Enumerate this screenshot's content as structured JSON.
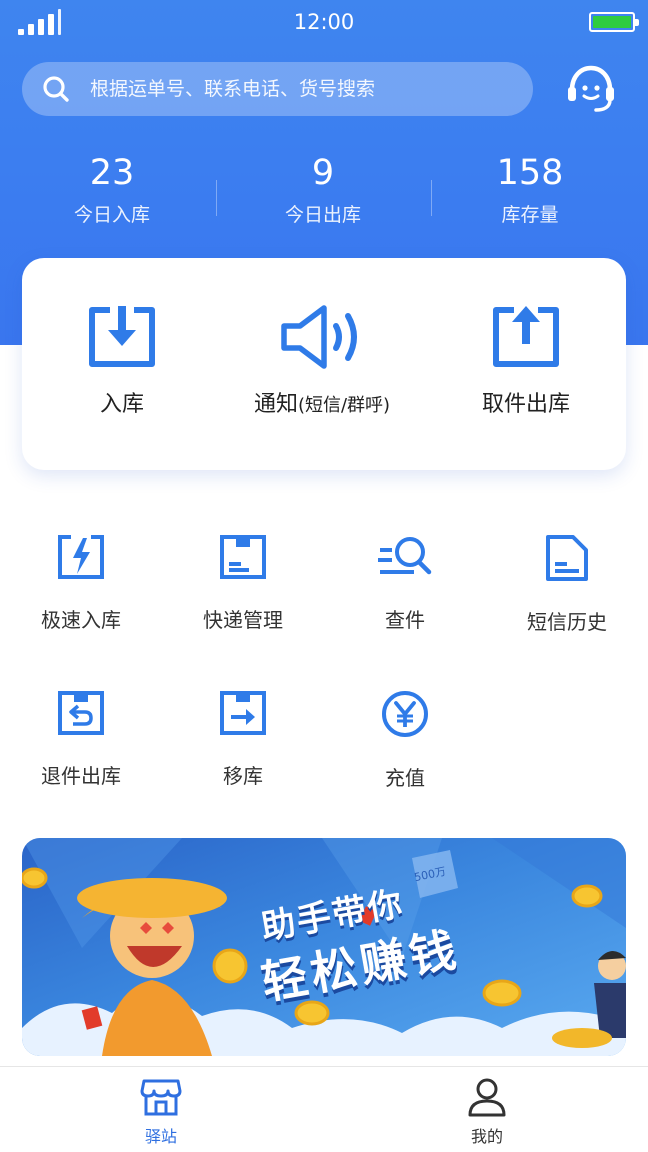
{
  "status_bar": {
    "time": "12:00"
  },
  "search": {
    "placeholder": "根据运单号、联系电话、货号搜索"
  },
  "stats": [
    {
      "value": "23",
      "label": "今日入库"
    },
    {
      "value": "9",
      "label": "今日出库"
    },
    {
      "value": "158",
      "label": "库存量"
    }
  ],
  "main_actions": {
    "inbound": "入库",
    "notify": "通知",
    "notify_sub": "(短信/群呼)",
    "pickup_outbound": "取件出库"
  },
  "grid": [
    {
      "label": "极速入库",
      "icon": "lightning-box-icon"
    },
    {
      "label": "快递管理",
      "icon": "parcel-box-icon"
    },
    {
      "label": "查件",
      "icon": "search-package-icon"
    },
    {
      "label": "短信历史",
      "icon": "document-icon"
    },
    {
      "label": "退件出库",
      "icon": "return-box-icon"
    },
    {
      "label": "移库",
      "icon": "move-box-icon"
    },
    {
      "label": "充值",
      "icon": "yuan-coin-icon"
    }
  ],
  "banner": {
    "line1": "助手带你",
    "line2": "轻松赚钱",
    "tag": "500万"
  },
  "tabbar": [
    {
      "label": "驿站",
      "active": true
    },
    {
      "label": "我的",
      "active": false
    }
  ],
  "colors": {
    "primary": "#3a7cf0",
    "icon_blue": "#2f7be8",
    "battery": "#2ecc40",
    "tab_active": "#2f6fe0",
    "tab_inactive": "#333333"
  }
}
